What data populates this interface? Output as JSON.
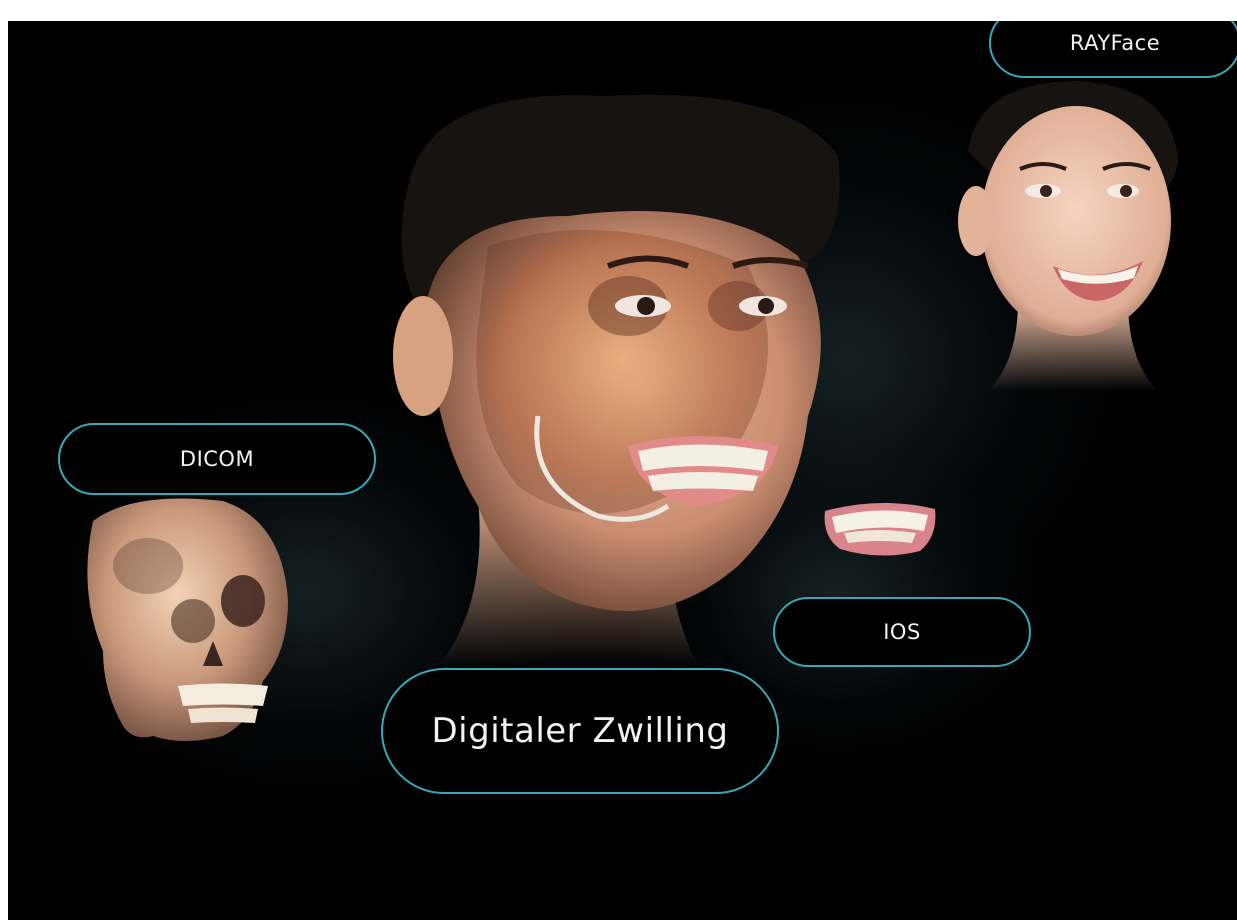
{
  "labels": {
    "rayface": "RAYFace",
    "dicom": "DICOM",
    "ios": "IOS",
    "digital_twin": "Digitaler Zwilling"
  },
  "colors": {
    "background": "#000000",
    "pill_border": "#3aa7b9",
    "text": "#f2f2f2"
  },
  "figures": {
    "main_face": "face-with-skull-overlay",
    "rayface_face": "smiling-face-photo",
    "skull": "skull-ct-render",
    "teeth": "dental-arch-scan"
  }
}
